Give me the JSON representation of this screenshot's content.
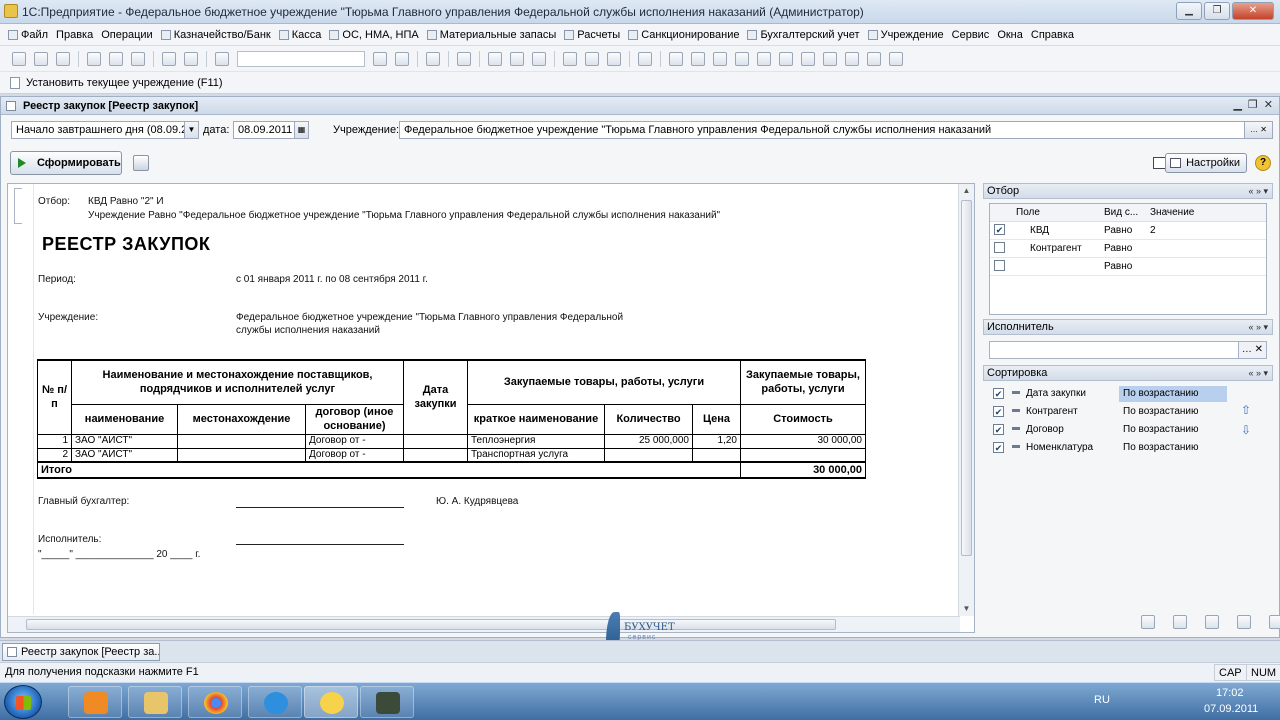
{
  "window": {
    "title": "1С:Предприятие - Федеральное бюджетное учреждение \"Тюрьма Главного управления Федеральной службы исполнения наказаний (Администратор)"
  },
  "menu": [
    "Файл",
    "Правка",
    "Операции",
    "Казначейство/Банк",
    "Касса",
    "ОС, НМА, НПА",
    "Материальные запасы",
    "Расчеты",
    "Санкционирование",
    "Бухгалтерский учет",
    "Учреждение",
    "Сервис",
    "Окна",
    "Справка"
  ],
  "toolbar2": {
    "set_current": "Установить текущее учреждение (F11)"
  },
  "doc": {
    "title": "Реестр закупок [Реестр закупок]",
    "period_option": "Начало завтрашнего дня (08.09.20",
    "date_label": "дата:",
    "date_value": "08.09.2011",
    "institution_label": "Учреждение:",
    "institution_value": "Федеральное бюджетное учреждение \"Тюрьма Главного управления Федеральной службы исполнения наказаний",
    "generate_button": "Сформировать",
    "settings_button": "Настройки",
    "help": "?"
  },
  "report": {
    "filter_label": "Отбор:",
    "filter_line1": "КВД Равно \"2\" И",
    "filter_line2": "Учреждение Равно \"Федеральное бюджетное учреждение \"Тюрьма Главного управления Федеральной службы исполнения наказаний\"",
    "title": "РЕЕСТР ЗАКУПОК",
    "period_label": "Период:",
    "period_value": "с 01 января 2011 г. по 08 сентября 2011 г.",
    "institution_label": "Учреждение:",
    "institution_line1": "Федеральное бюджетное учреждение \"Тюрьма Главного управления Федеральной",
    "institution_line2": "службы исполнения наказаний",
    "headers": {
      "num": "№ п/п",
      "supplier": "Наименование и местонахождение поставщиков, подрядчиков и исполнителей услуг",
      "name": "наименование",
      "location": "местонахождение",
      "contract": "договор (иное основание)",
      "date": "Дата закупки",
      "goods": "Закупаемые товары, работы, услуги",
      "short_name": "краткое наименование",
      "qty": "Количество",
      "price": "Цена",
      "cost_group": "Закупаемые товары, работы, услуги",
      "cost": "Стоимость"
    },
    "rows": [
      {
        "n": "1",
        "name": "ЗАО \"АИСТ\"",
        "location": "",
        "contract": "Договор  от -",
        "date": "",
        "short": "Теплоэнергия",
        "qty": "25 000,000",
        "price": "1,20",
        "cost": "30 000,00"
      },
      {
        "n": "2",
        "name": "ЗАО \"АИСТ\"",
        "location": "",
        "contract": "Договор  от -",
        "date": "",
        "short": "Транспортная услуга",
        "qty": "",
        "price": "",
        "cost": ""
      }
    ],
    "total_label": "Итого",
    "total_value": "30 000,00",
    "chief_accountant_label": "Главный бухгалтер:",
    "chief_accountant_name": "Ю. А. Кудрявцева",
    "executor_label": "Исполнитель:",
    "date_template": "\"_____\" ______________ 20 ____ г."
  },
  "panel": {
    "filter_title": "Отбор",
    "filter_cols": [
      "Поле",
      "Вид с...",
      "Значение"
    ],
    "filter_rows": [
      {
        "checked": true,
        "field": "КВД",
        "kind": "Равно",
        "value": "2"
      },
      {
        "checked": false,
        "field": "Контрагент",
        "kind": "Равно",
        "value": ""
      },
      {
        "checked": false,
        "field": "",
        "kind": "Равно",
        "value": ""
      }
    ],
    "executor_title": "Исполнитель",
    "sort_title": "Сортировка",
    "sort_rows": [
      {
        "field": "Дата закупки",
        "order": "По возрастанию"
      },
      {
        "field": "Контрагент",
        "order": "По возрастанию"
      },
      {
        "field": "Договор",
        "order": "По возрастанию"
      },
      {
        "field": "Номенклатура",
        "order": "По возрастанию"
      }
    ],
    "nav": "« » ▾"
  },
  "tab": {
    "label": "Реестр закупок [Реестр за..."
  },
  "status": {
    "hint": "Для получения подсказки нажмите F1",
    "cap": "CAP",
    "num": "NUM"
  },
  "taskbar": {
    "lang": "RU",
    "time": "17:02",
    "date": "07.09.2011"
  },
  "watermark": {
    "line1": "БУХУЧЕТ",
    "line2": "сервис"
  }
}
